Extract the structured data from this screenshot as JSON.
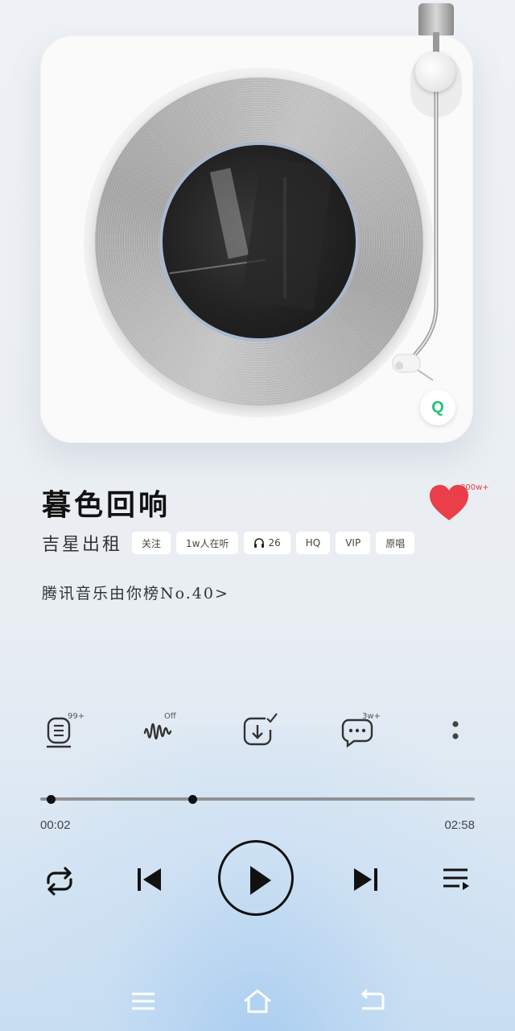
{
  "song": {
    "title": "暮色回响",
    "artist": "吉星出租",
    "like_count": "800w+",
    "chart_link": "腾讯音乐由你榜No.40>"
  },
  "chips": [
    {
      "label": "关注",
      "icon": ""
    },
    {
      "label": "1w人在听",
      "icon": ""
    },
    {
      "label": "26",
      "icon": "headphones-icon"
    },
    {
      "label": "HQ",
      "icon": ""
    },
    {
      "label": "VIP",
      "icon": ""
    },
    {
      "label": "原唱",
      "icon": ""
    }
  ],
  "actions": {
    "lyrics_badge": "99+",
    "effect_badge": "Off",
    "comments_badge": "3w+"
  },
  "player": {
    "current_time": "00:02",
    "total_time": "02:58",
    "progress_fraction": 0.011,
    "buffered_fraction": 0.35
  },
  "brand": {
    "logo_letter": "Q",
    "accent": "#1fc377",
    "like_color": "#ea3f48"
  },
  "icons": {
    "repeat": "repeat-icon",
    "prev": "skip-previous-icon",
    "play": "play-icon",
    "next": "skip-next-icon",
    "playlist": "playlist-icon",
    "nav_menu": "menu-icon",
    "nav_home": "home-icon",
    "nav_back": "back-icon"
  }
}
